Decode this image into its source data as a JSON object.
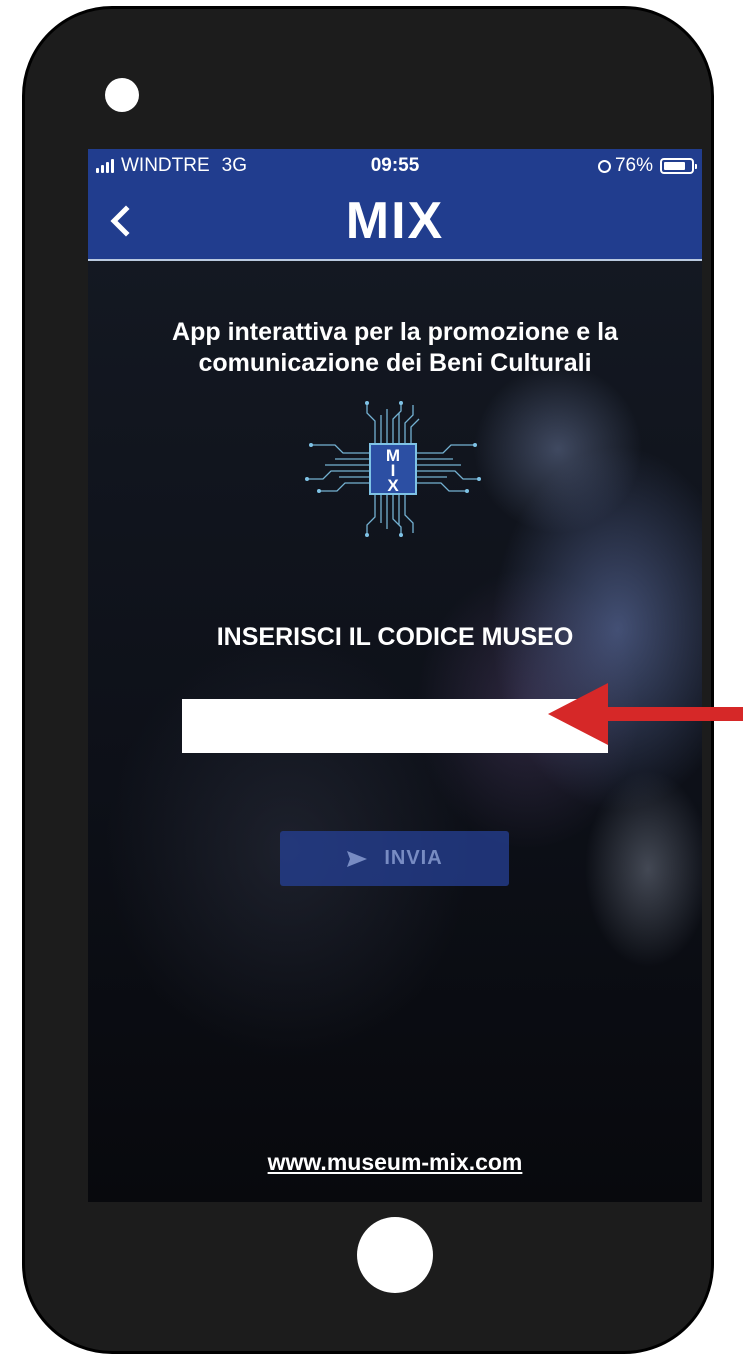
{
  "status_bar": {
    "carrier": "WINDTRE",
    "network": "3G",
    "time": "09:55",
    "battery": "76%",
    "signal_icon": "signal-bars-icon",
    "rotation_lock_icon": "rotation-lock-icon",
    "battery_icon": "battery-icon"
  },
  "nav": {
    "back_icon": "chevron-left-icon",
    "back_glyph": "<",
    "title": "MIX",
    "color": "#213d8e"
  },
  "main": {
    "tagline": "App interattiva per la promozione e la comunicazione dei Beni Culturali",
    "logo": {
      "icon": "mix-chip-logo",
      "letters": [
        "M",
        "I",
        "X"
      ]
    },
    "instruction": "INSERISCI IL CODICE MUSEO",
    "code_input": {
      "value": "",
      "placeholder": ""
    },
    "send_button": {
      "label": "INVIA",
      "icon": "send-arrow-icon"
    },
    "website": "www.museum-mix.com"
  },
  "annotation": {
    "icon": "red-arrow-icon",
    "color": "#d62828"
  }
}
